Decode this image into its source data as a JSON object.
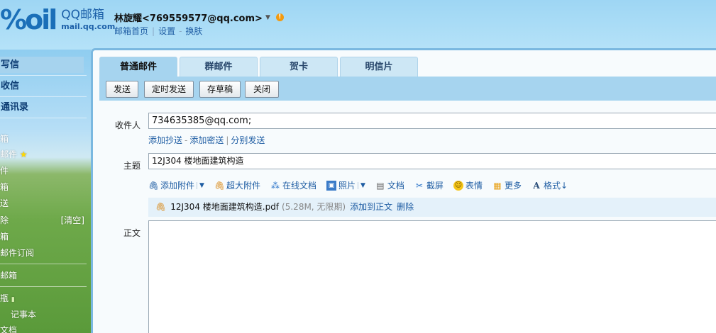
{
  "app": {
    "logo_mark": "%oil",
    "logo_name": "QQ邮箱",
    "logo_url": "mail.qq.com"
  },
  "user": {
    "display": "林旋耀<769559577@qq.com>",
    "warn_symbol": "!",
    "links": [
      "邮箱首页",
      "设置",
      "换肤"
    ]
  },
  "sidebar": {
    "main_items": [
      "写信",
      "收信",
      "通讯录"
    ],
    "folders": [
      "箱",
      "邮件",
      "件",
      "箱",
      "送",
      "除",
      "箱",
      "邮件订阅"
    ],
    "clear_label": "[清空]",
    "section2": "邮箱",
    "section3": "瓶",
    "sub1": "记事本",
    "sub2": "文档"
  },
  "compose": {
    "tabs": [
      "普通邮件",
      "群邮件",
      "贺卡",
      "明信片"
    ],
    "actions": [
      "发送",
      "定时发送",
      "存草稿",
      "关闭"
    ],
    "to_label": "收件人",
    "to_value": "734635385@qq.com;",
    "cc_links": [
      "添加抄送",
      "添加密送",
      "分别发送"
    ],
    "subject_label": "主题",
    "subject_value": "12J304 楼地面建筑构造",
    "attach_tools": [
      "添加附件",
      "超大附件",
      "在线文档",
      "照片",
      "文档",
      "截屏",
      "表情",
      "更多",
      "格式↓"
    ],
    "attachment": {
      "name": "12J304 楼地面建筑构造.pdf",
      "meta": "(5.28M, 无限期)",
      "add_to_body": "添加到正文",
      "delete": "删除"
    },
    "body_label": "正文"
  },
  "colors": {
    "accent": "#1f5da3",
    "toolbar_bg": "#a6d4ef",
    "header_bg": "#9ed6f4"
  }
}
